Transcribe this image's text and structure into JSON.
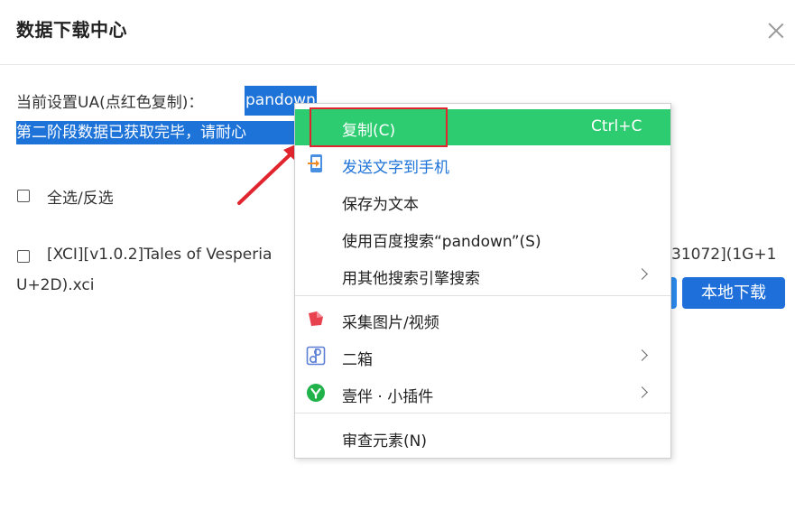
{
  "dialog": {
    "title": "数据下载中心",
    "ua_label": "当前设置UA(点红色复制)：",
    "ua_value": "pandown",
    "status_text": "第二阶段数据已获取完毕，请耐心",
    "select_all_label": "全选/反选",
    "file_name_part1": "[XCI][v1.0.2]Tales of Vesperia",
    "file_name_part2": "31072](1G+1",
    "file_name_line2": "U+2D).xci",
    "local_download_label": "本地下载"
  },
  "context_menu": {
    "items": [
      {
        "label": "复制(C)",
        "shortcut": "Ctrl+C",
        "highlighted": true
      },
      {
        "label": "发送文字到手机",
        "icon": "send-to-phone-icon"
      },
      {
        "label": "保存为文本"
      },
      {
        "label": "使用百度搜索“pandown”(S)"
      },
      {
        "label": "用其他搜索引擎搜索",
        "submenu": true
      },
      {
        "label": "采集图片/视频",
        "icon": "collect-media-icon"
      },
      {
        "label": "二箱",
        "icon": "erxiang-icon",
        "submenu": true
      },
      {
        "label": "壹伴 · 小插件",
        "icon": "yiban-icon",
        "submenu": true
      },
      {
        "label": "审查元素(N)"
      }
    ]
  },
  "colors": {
    "selection": "#1e73d8",
    "menu_highlight": "#2ecc71",
    "annotation_red": "#e0252e",
    "button_blue": "#1e6fd9"
  }
}
